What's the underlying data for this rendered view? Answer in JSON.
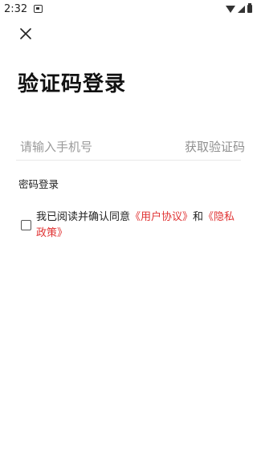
{
  "status_bar": {
    "time": "2:32"
  },
  "icons": {
    "close": "close-icon",
    "notification": "notification-icon",
    "wifi": "wifi-icon",
    "signal": "signal-icon",
    "battery": "battery-icon",
    "checkbox": "checkbox-unchecked-icon"
  },
  "colors": {
    "link_red": "#e03333",
    "placeholder": "#9a9a9a"
  },
  "page": {
    "title": "验证码登录"
  },
  "phone_field": {
    "value": "",
    "placeholder": "请输入手机号",
    "get_code_label": "获取验证码"
  },
  "password_login_label": "密码登录",
  "agreement": {
    "checked": false,
    "prefix": "我已阅读并确认同意",
    "user_agreement": "《用户协议》",
    "and": "和",
    "privacy_policy": "《隐私政策》"
  }
}
